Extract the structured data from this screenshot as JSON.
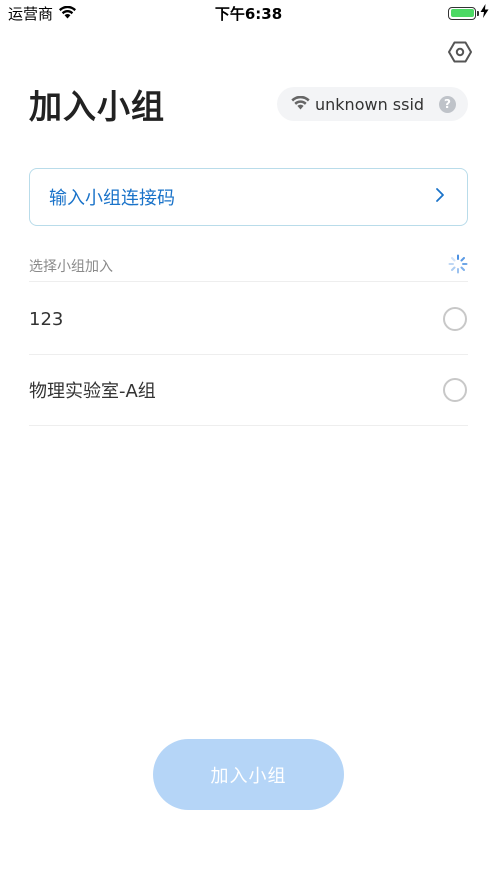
{
  "status_bar": {
    "carrier": "运营商",
    "time": "下午6:38"
  },
  "header": {
    "title": "加入小组",
    "wifi": {
      "ssid": "unknown ssid",
      "help_symbol": "?"
    }
  },
  "code_entry": {
    "label": "输入小组连接码"
  },
  "section": {
    "label": "选择小组加入"
  },
  "groups": [
    {
      "name": "123",
      "selected": false
    },
    {
      "name": "物理实验室-A组",
      "selected": false
    }
  ],
  "join_button": {
    "label": "加入小组"
  },
  "colors": {
    "accent": "#1a73c9",
    "button_disabled": "#b5d5f7",
    "battery": "#4cd964"
  },
  "icons": [
    "wifi-icon",
    "battery-icon",
    "settings-hexagon-icon",
    "help-icon",
    "chevron-right-icon",
    "loading-spinner-icon"
  ]
}
